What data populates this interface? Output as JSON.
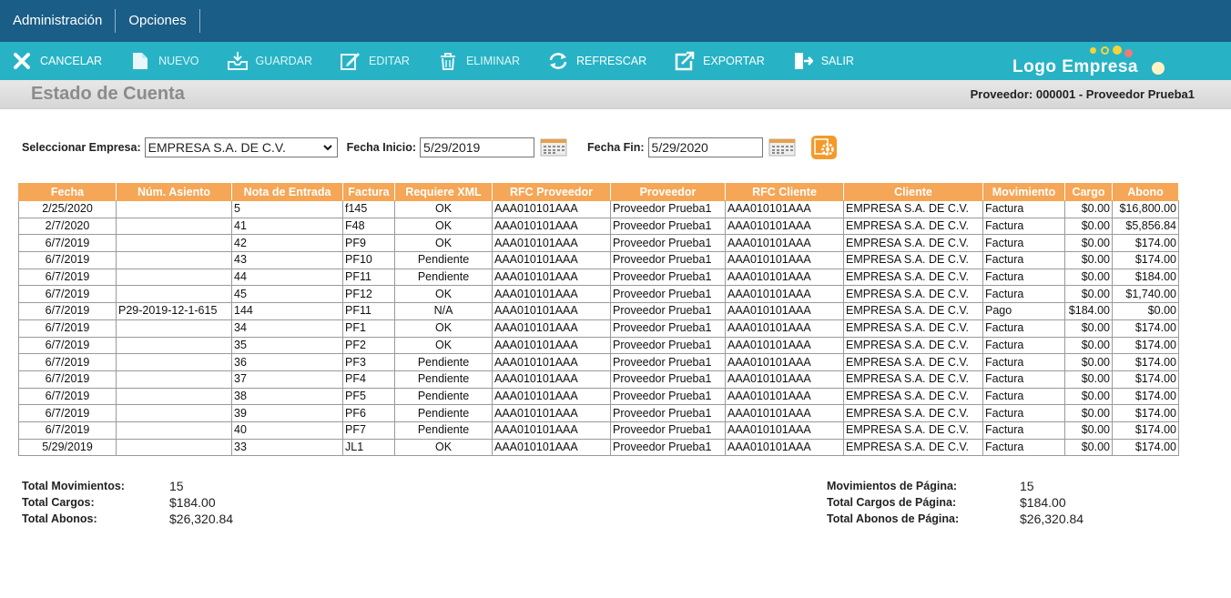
{
  "menu": [
    "Administración",
    "Opciones"
  ],
  "toolbar": [
    {
      "label": "CANCELAR",
      "icon": "x-icon"
    },
    {
      "label": "NUEVO",
      "icon": "new-document-icon"
    },
    {
      "label": "GUARDAR",
      "icon": "save-tray-icon"
    },
    {
      "label": "EDITAR",
      "icon": "edit-icon"
    },
    {
      "label": "ELIMINAR",
      "icon": "trash-icon"
    },
    {
      "label": "REFRESCAR",
      "icon": "refresh-icon"
    },
    {
      "label": "EXPORTAR",
      "icon": "export-icon"
    },
    {
      "label": "SALIR",
      "icon": "exit-icon"
    }
  ],
  "logo": {
    "text": "Logo Empresa"
  },
  "header": {
    "title": "Estado de Cuenta",
    "provider": "Proveedor: 000001 - Proveedor Prueba1"
  },
  "filters": {
    "empresa_label": "Seleccionar Empresa:",
    "empresa_value": "EMPRESA S.A. DE C.V.",
    "fecha_inicio_label": "Fecha Inicio:",
    "fecha_inicio": "5/29/2019",
    "fecha_fin_label": "Fecha Fin:",
    "fecha_fin": "5/29/2020"
  },
  "table": {
    "columns": [
      "Fecha",
      "Núm. Asiento",
      "Nota de Entrada",
      "Factura",
      "Requiere XML",
      "RFC Proveedor",
      "Proveedor",
      "RFC Cliente",
      "Cliente",
      "Movimiento",
      "Cargo",
      "Abono"
    ],
    "rows": [
      [
        "2/25/2020",
        "",
        "5",
        "f145",
        "OK",
        "AAA010101AAA",
        "Proveedor Prueba1",
        "AAA010101AAA",
        "EMPRESA S.A. DE C.V.",
        "Factura",
        "$0.00",
        "$16,800.00"
      ],
      [
        "2/7/2020",
        "",
        "41",
        "F48",
        "OK",
        "AAA010101AAA",
        "Proveedor Prueba1",
        "AAA010101AAA",
        "EMPRESA S.A. DE C.V.",
        "Factura",
        "$0.00",
        "$5,856.84"
      ],
      [
        "6/7/2019",
        "",
        "42",
        "PF9",
        "OK",
        "AAA010101AAA",
        "Proveedor Prueba1",
        "AAA010101AAA",
        "EMPRESA S.A. DE C.V.",
        "Factura",
        "$0.00",
        "$174.00"
      ],
      [
        "6/7/2019",
        "",
        "43",
        "PF10",
        "Pendiente",
        "AAA010101AAA",
        "Proveedor Prueba1",
        "AAA010101AAA",
        "EMPRESA S.A. DE C.V.",
        "Factura",
        "$0.00",
        "$174.00"
      ],
      [
        "6/7/2019",
        "",
        "44",
        "PF11",
        "Pendiente",
        "AAA010101AAA",
        "Proveedor Prueba1",
        "AAA010101AAA",
        "EMPRESA S.A. DE C.V.",
        "Factura",
        "$0.00",
        "$184.00"
      ],
      [
        "6/7/2019",
        "",
        "45",
        "PF12",
        "OK",
        "AAA010101AAA",
        "Proveedor Prueba1",
        "AAA010101AAA",
        "EMPRESA S.A. DE C.V.",
        "Factura",
        "$0.00",
        "$1,740.00"
      ],
      [
        "6/7/2019",
        "P29-2019-12-1-615",
        "144",
        "PF11",
        "N/A",
        "AAA010101AAA",
        "Proveedor Prueba1",
        "AAA010101AAA",
        "EMPRESA S.A. DE C.V.",
        "Pago",
        "$184.00",
        "$0.00"
      ],
      [
        "6/7/2019",
        "",
        "34",
        "PF1",
        "OK",
        "AAA010101AAA",
        "Proveedor Prueba1",
        "AAA010101AAA",
        "EMPRESA S.A. DE C.V.",
        "Factura",
        "$0.00",
        "$174.00"
      ],
      [
        "6/7/2019",
        "",
        "35",
        "PF2",
        "OK",
        "AAA010101AAA",
        "Proveedor Prueba1",
        "AAA010101AAA",
        "EMPRESA S.A. DE C.V.",
        "Factura",
        "$0.00",
        "$174.00"
      ],
      [
        "6/7/2019",
        "",
        "36",
        "PF3",
        "Pendiente",
        "AAA010101AAA",
        "Proveedor Prueba1",
        "AAA010101AAA",
        "EMPRESA S.A. DE C.V.",
        "Factura",
        "$0.00",
        "$174.00"
      ],
      [
        "6/7/2019",
        "",
        "37",
        "PF4",
        "Pendiente",
        "AAA010101AAA",
        "Proveedor Prueba1",
        "AAA010101AAA",
        "EMPRESA S.A. DE C.V.",
        "Factura",
        "$0.00",
        "$174.00"
      ],
      [
        "6/7/2019",
        "",
        "38",
        "PF5",
        "Pendiente",
        "AAA010101AAA",
        "Proveedor Prueba1",
        "AAA010101AAA",
        "EMPRESA S.A. DE C.V.",
        "Factura",
        "$0.00",
        "$174.00"
      ],
      [
        "6/7/2019",
        "",
        "39",
        "PF6",
        "Pendiente",
        "AAA010101AAA",
        "Proveedor Prueba1",
        "AAA010101AAA",
        "EMPRESA S.A. DE C.V.",
        "Factura",
        "$0.00",
        "$174.00"
      ],
      [
        "6/7/2019",
        "",
        "40",
        "PF7",
        "Pendiente",
        "AAA010101AAA",
        "Proveedor Prueba1",
        "AAA010101AAA",
        "EMPRESA S.A. DE C.V.",
        "Factura",
        "$0.00",
        "$174.00"
      ],
      [
        "5/29/2019",
        "",
        "33",
        "JL1",
        "OK",
        "AAA010101AAA",
        "Proveedor Prueba1",
        "AAA010101AAA",
        "EMPRESA S.A. DE C.V.",
        "Factura",
        "$0.00",
        "$174.00"
      ]
    ]
  },
  "totals_left": [
    {
      "label": "Total Movimientos:",
      "value": "15"
    },
    {
      "label": "Total Cargos:",
      "value": "$184.00"
    },
    {
      "label": "Total Abonos:",
      "value": "$26,320.84"
    }
  ],
  "totals_right": [
    {
      "label": "Movimientos de Página:",
      "value": "15"
    },
    {
      "label": "Total Cargos de Página:",
      "value": "$184.00"
    },
    {
      "label": "Total Abonos de Página:",
      "value": "$26,320.84"
    }
  ],
  "colors": {
    "topbar": "#1a5d86",
    "toolbar": "#27b3c5",
    "table_header": "#f5a656",
    "action_button": "#f39a2b"
  }
}
